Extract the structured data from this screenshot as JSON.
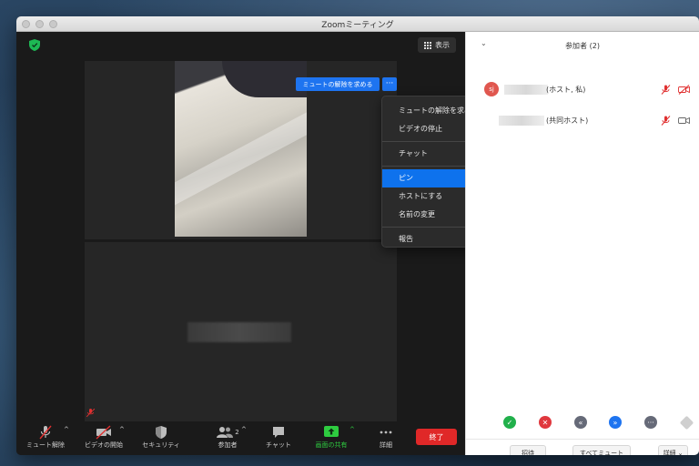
{
  "window": {
    "title": "Zoomミーティング"
  },
  "video": {
    "view_label": "表示",
    "unmute_request_label": "ミュートの解除を求める",
    "more_label": "···"
  },
  "context_menu": {
    "items": [
      "ミュートの解除を求める",
      "ビデオの停止",
      "チャット",
      "ピン",
      "ホストにする",
      "名前の変更",
      "報告"
    ],
    "active_item": "ピン"
  },
  "toolbar": {
    "unmute": "ミュート解除",
    "start_video": "ビデオの開始",
    "security": "セキュリティ",
    "participants": "参加者",
    "participants_count": "2",
    "chat": "チャット",
    "share_screen": "画面の共有",
    "more": "詳細",
    "end": "終了"
  },
  "participants_panel": {
    "title": "参加者 (2)",
    "participants": [
      {
        "initials": "sj",
        "role": "(ホスト, 私)"
      },
      {
        "initials": "",
        "role": "(共同ホスト)"
      }
    ],
    "footer": {
      "invite": "招待",
      "mute_all": "すべてミュート",
      "more": "詳細"
    }
  },
  "colors": {
    "accent_blue": "#1e74f0",
    "end_red": "#e02828",
    "share_green": "#2ecc40",
    "avatar_red": "#e0574f"
  }
}
